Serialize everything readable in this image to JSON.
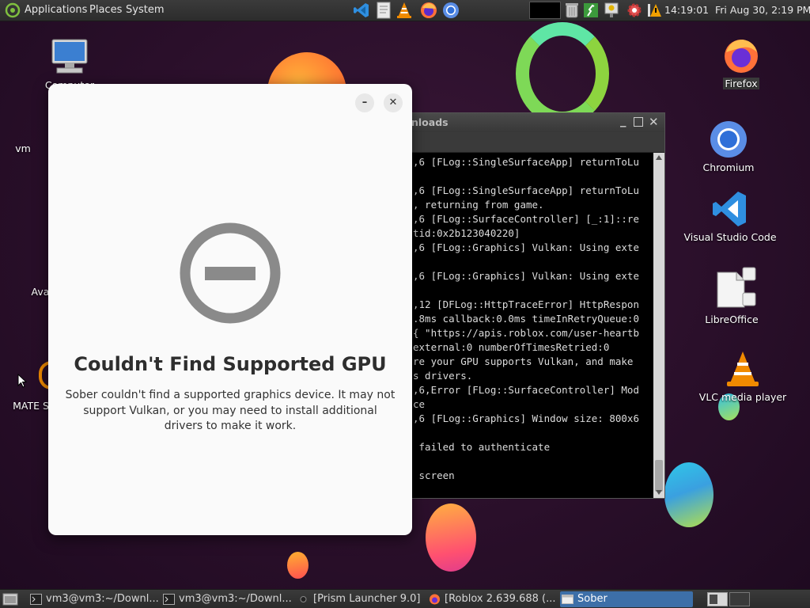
{
  "top_panel": {
    "menus": [
      "Applications",
      "Places",
      "System"
    ],
    "time_small": "14:19:01",
    "datetime": "Fri Aug 30,  2:19 PM"
  },
  "desktop_icons": {
    "computer": "Computer",
    "firefox": "Firefox",
    "chromium": "Chromium",
    "vscode": "Visual Studio Code",
    "libreoffice": "LibreOffice",
    "vlc": "VLC media player",
    "vm": "vm",
    "ava": "Ava",
    "mate": "MATE S"
  },
  "terminal": {
    "title": "nloads",
    "lines": [
      ",6 [FLog::SingleSurfaceApp] returnToLu",
      "",
      ",6 [FLog::SingleSurfaceApp] returnToLu",
      ", returning from game.",
      ",6 [FLog::SurfaceController] [_:1]::re",
      "tid:0x2b123040220]",
      ",6 [FLog::Graphics] Vulkan: Using exte",
      "",
      ",6 [FLog::Graphics] Vulkan: Using exte",
      "",
      ",12 [DFLog::HttpTraceError] HttpRespon",
      ".8ms callback:0.0ms timeInRetryQueue:0",
      "{ \"https://apis.roblox.com/user-heartb",
      "external:0 numberOfTimesRetried:0",
      "re your GPU supports Vulkan, and make",
      "s drivers.",
      ",6,Error [FLog::SurfaceController] Mod",
      "ce",
      ",6 [FLog::Graphics] Window size: 800x6",
      "",
      " failed to authenticate",
      "",
      " screen"
    ]
  },
  "dialog": {
    "title": "Couldn't Find Supported GPU",
    "message": "Sober couldn't find a supported graphics device. It may not support Vulkan, or you may need to install additional drivers to make it work.",
    "minimize": "–",
    "close": "✕"
  },
  "taskbar": {
    "tasks": [
      "vm3@vm3:~/Downl...",
      "vm3@vm3:~/Downl...",
      "[Prism Launcher 9.0]",
      "[Roblox 2.639.688 (...",
      "Sober"
    ]
  },
  "colors": {
    "accent": "#3d6fa8",
    "dialog_bg": "#fafafa",
    "error_icon": "#8a8a8a"
  }
}
